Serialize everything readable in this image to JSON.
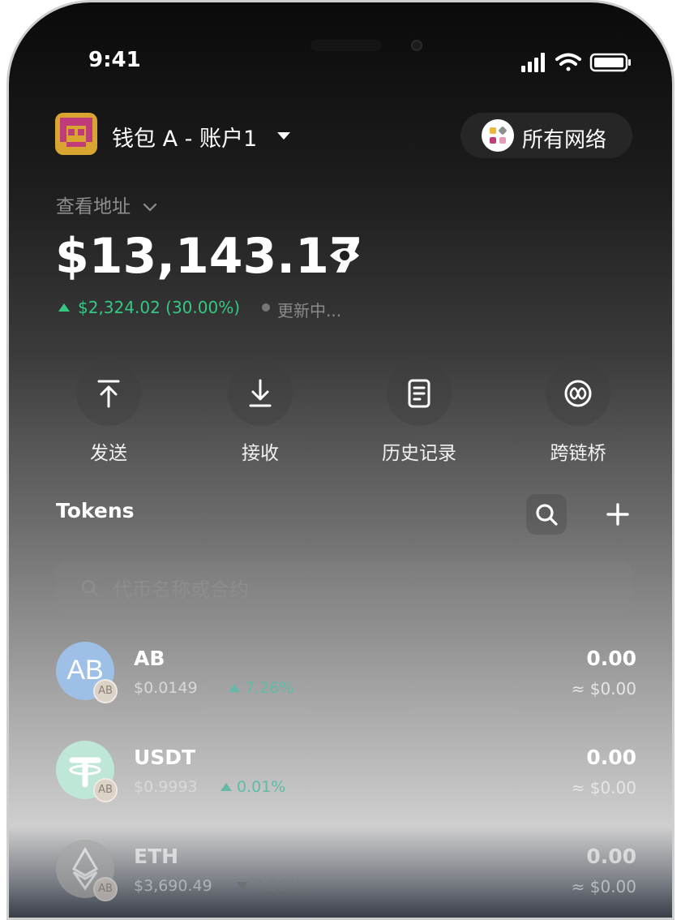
{
  "status_bar": {
    "time": "9:41"
  },
  "header": {
    "wallet_name": "钱包 A - 账户1",
    "network_label": "所有网络",
    "view_address": "查看地址",
    "balance": "$13,143.17",
    "change": "$2,324.02  (30.00%)",
    "updating": "更新中..."
  },
  "actions": [
    {
      "label": "发送",
      "icon": "send-icon"
    },
    {
      "label": "接收",
      "icon": "receive-icon"
    },
    {
      "label": "历史记录",
      "icon": "history-icon"
    },
    {
      "label": "跨链桥",
      "icon": "bridge-icon"
    }
  ],
  "tokens": {
    "title": "Tokens",
    "search_placeholder": "代币名称或合约",
    "items": [
      {
        "symbol": "AB",
        "price": "$0.0149",
        "change": "7.26%",
        "direction": "up",
        "amount": "0.00",
        "fiat": "≈ $0.00",
        "color": "#9fc0e6"
      },
      {
        "symbol": "USDT",
        "price": "$0.9993",
        "change": "0.01%",
        "direction": "up",
        "amount": "0.00",
        "fiat": "≈ $0.00",
        "color": "#bfe7d7"
      },
      {
        "symbol": "ETH",
        "price": "$3,690.49",
        "change": "7.26%",
        "direction": "down",
        "amount": "0.00",
        "fiat": "≈ $0.00",
        "color": "#a7a7a7"
      }
    ]
  },
  "colors": {
    "positive": "#35c883",
    "negative": "#6b6b6b"
  }
}
